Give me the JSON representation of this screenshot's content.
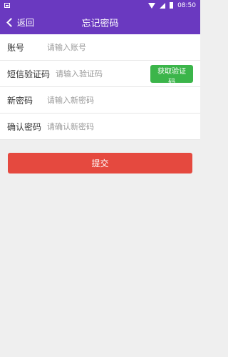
{
  "status_bar": {
    "time": "08:50",
    "icons": [
      "notification-icon",
      "wifi-icon",
      "signal-icon",
      "battery-icon"
    ]
  },
  "header": {
    "back_label": "返回",
    "title": "忘记密码",
    "background": "#6a39c0"
  },
  "form": {
    "account": {
      "label": "账号",
      "placeholder": "请输入账号",
      "value": ""
    },
    "sms_code": {
      "label": "短信验证码",
      "placeholder": "请输入验证码",
      "value": "",
      "button_label": "获取验证码"
    },
    "new_password": {
      "label": "新密码",
      "placeholder": "请输入新密码",
      "value": ""
    },
    "confirm_password": {
      "label": "确认密码",
      "placeholder": "请确认新密码",
      "value": ""
    }
  },
  "submit": {
    "label": "提交"
  },
  "colors": {
    "primary": "#6a39c0",
    "code_button": "#3bb54a",
    "submit_button": "#e5493f",
    "page_background": "#efefef"
  }
}
